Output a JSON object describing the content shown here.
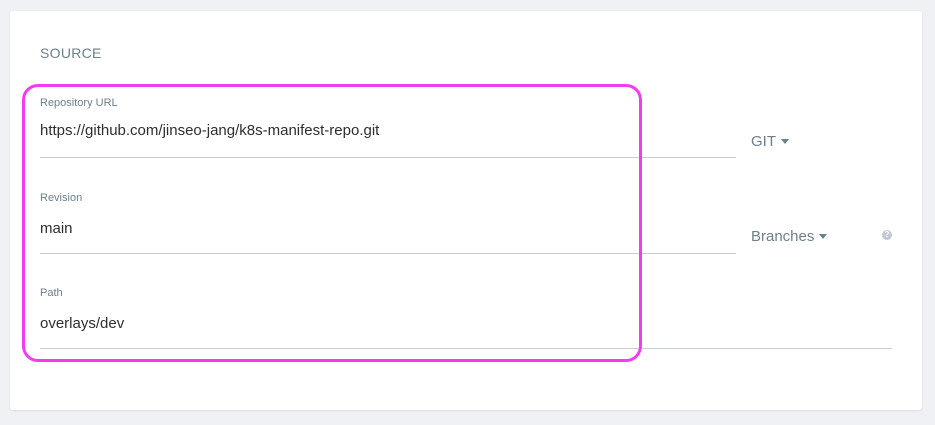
{
  "section": {
    "title": "SOURCE"
  },
  "repository": {
    "label": "Repository URL",
    "value": "https://github.com/jinseo-jang/k8s-manifest-repo.git",
    "type_selector": "GIT"
  },
  "revision": {
    "label": "Revision",
    "value": "main",
    "type_selector": "Branches"
  },
  "path": {
    "label": "Path",
    "value": "overlays/dev"
  },
  "help_icon_glyph": "?",
  "colors": {
    "highlight": "#f23cf0",
    "label": "#6d7f8b",
    "value": "#2b2f33"
  }
}
